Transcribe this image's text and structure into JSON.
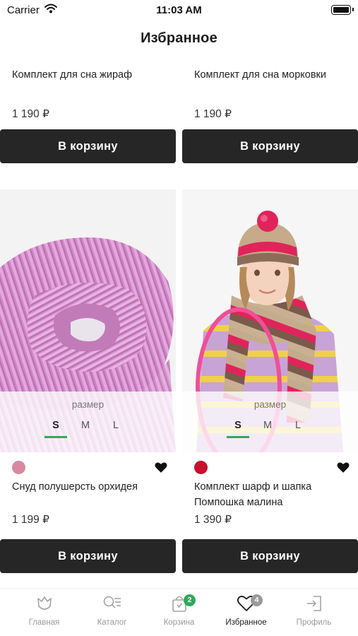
{
  "status_bar": {
    "carrier": "Carrier",
    "time": "11:03 AM"
  },
  "header": {
    "title": "Избранное"
  },
  "cart_button_label": "В корзину",
  "top_products": [
    {
      "name": "Комплект для сна жираф",
      "price": "1 190 ₽"
    },
    {
      "name": "Комплект для сна морковки",
      "price": "1 190 ₽"
    }
  ],
  "products": [
    {
      "name": "Снуд полушерсть орхидея",
      "price": "1 199 ₽",
      "color": "#d9899f",
      "size_label": "размер",
      "sizes": [
        "S",
        "M",
        "L"
      ],
      "selected_size": "S",
      "favorite": true
    },
    {
      "name": "Комплект шарф и шапка Помпошка малина",
      "price": "1 390 ₽",
      "color": "#c8102e",
      "size_label": "размер",
      "sizes": [
        "S",
        "M",
        "L"
      ],
      "selected_size": "S",
      "favorite": true
    }
  ],
  "tab_bar": {
    "tabs": [
      {
        "label": "Главная",
        "icon": "tulip-icon"
      },
      {
        "label": "Каталог",
        "icon": "catalog-search-icon"
      },
      {
        "label": "Корзина",
        "icon": "shopping-bag-icon",
        "badge": "2",
        "badge_color": "#2faa5a"
      },
      {
        "label": "Избранное",
        "icon": "heart-icon",
        "badge": "4",
        "badge_color": "#9b9b9b",
        "active": true
      },
      {
        "label": "Профиль",
        "icon": "login-icon"
      }
    ]
  },
  "colors": {
    "accent_green": "#2faa5a",
    "button_bg": "#262626"
  }
}
